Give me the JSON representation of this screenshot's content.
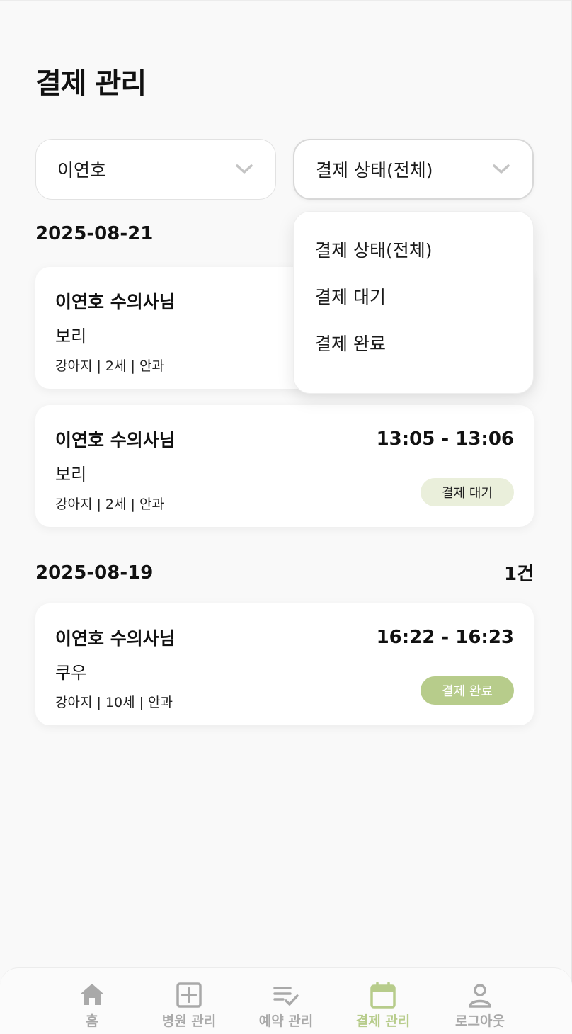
{
  "page": {
    "title": "결제 관리"
  },
  "filters": {
    "doctor": "이연호",
    "status": "결제 상태(전체)"
  },
  "status_dropdown": {
    "options": [
      "결제 상태(전체)",
      "결제 대기",
      "결제 완료"
    ]
  },
  "groups": [
    {
      "date": "2025-08-21",
      "cards": [
        {
          "doctor": "이연호 수의사님",
          "pet": "보리",
          "info": "강아지 | 2세 | 안과"
        },
        {
          "doctor": "이연호 수의사님",
          "pet": "보리",
          "info": "강아지 | 2세 | 안과",
          "time": "13:05 - 13:06",
          "status": "결제 대기"
        }
      ]
    },
    {
      "date": "2025-08-19",
      "count": "1건",
      "cards": [
        {
          "doctor": "이연호 수의사님",
          "pet": "쿠우",
          "info": "강아지 | 10세 | 안과",
          "time": "16:22 - 16:23",
          "status": "결제 완료"
        }
      ]
    }
  ],
  "nav": {
    "items": [
      {
        "label": "홈",
        "icon": "home-icon"
      },
      {
        "label": "병원 관리",
        "icon": "hospital-plus-icon"
      },
      {
        "label": "예약 관리",
        "icon": "checklist-icon"
      },
      {
        "label": "결제 관리",
        "icon": "calendar-icon",
        "active": true
      },
      {
        "label": "로그아웃",
        "icon": "user-icon"
      }
    ]
  },
  "colors": {
    "accent": "#b7cc8b",
    "badge_wait_bg": "#eaefdb",
    "nav_inactive": "#a9a9a9"
  }
}
